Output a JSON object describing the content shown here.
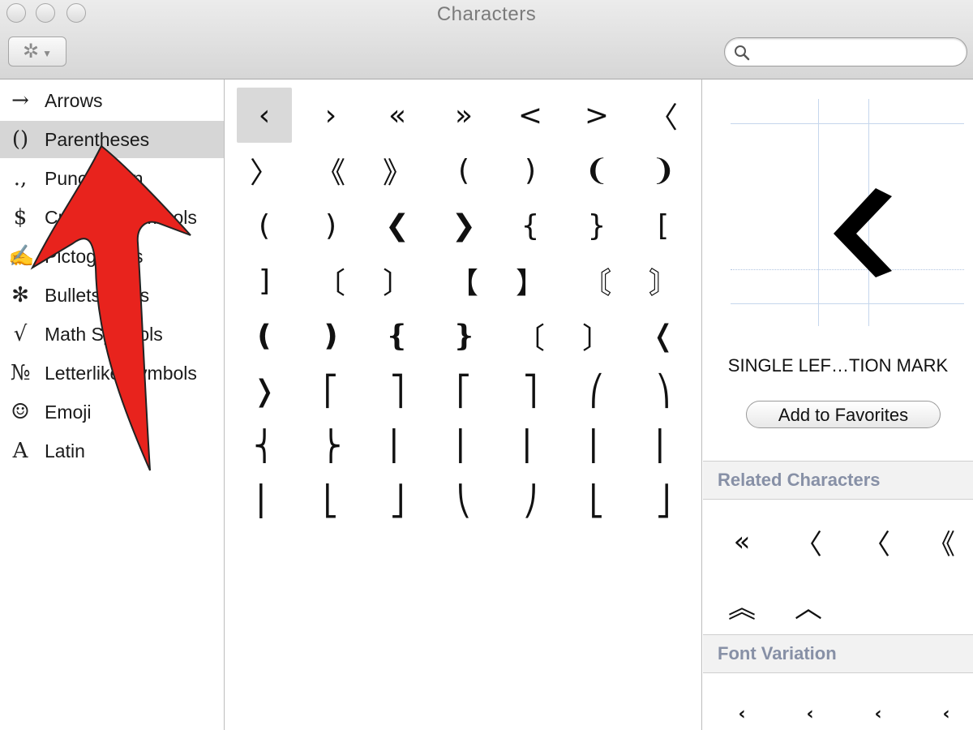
{
  "window": {
    "title": "Characters"
  },
  "toolbar": {
    "gear_icon": "gear-icon",
    "search_placeholder": ""
  },
  "sidebar": {
    "items": [
      {
        "glyph": "→",
        "label": "Arrows"
      },
      {
        "glyph": "()",
        "label": "Parentheses",
        "selected": true
      },
      {
        "glyph": ".,",
        "label": "Punctuation"
      },
      {
        "glyph": "$",
        "label": "Currency Symbols"
      },
      {
        "glyph": "✍",
        "label": "Pictographs"
      },
      {
        "glyph": "✻",
        "label": "Bullets/Stars"
      },
      {
        "glyph": "√",
        "label": "Math Symbols"
      },
      {
        "glyph": "№",
        "label": "Letterlike Symbols"
      },
      {
        "glyph": "☺",
        "label": "Emoji"
      },
      {
        "glyph": "A",
        "label": "Latin"
      }
    ]
  },
  "grid": {
    "selected_index": 0,
    "characters": [
      "‹",
      "›",
      "«",
      "»",
      "<",
      ">",
      "〈",
      "〉",
      "《",
      "》",
      "(",
      ")",
      "❨",
      "❩",
      "(",
      ")",
      "❮",
      "❯",
      "{",
      "}",
      "[",
      "]",
      "〔",
      "〕",
      "【",
      "】",
      "〘",
      "〙",
      "❪",
      "❫",
      "❴",
      "❵",
      "〔",
      "〕",
      "❬",
      "❭",
      "⎡",
      "⎤",
      "⎡",
      "⎤",
      "⎛",
      "⎞",
      "⎨",
      "⎬",
      "⎢",
      "⎢",
      "⎢",
      "⎢",
      "⎢",
      "⎢",
      "⎣",
      "⎦",
      "⎝",
      "⎠",
      "⎣",
      "⎦"
    ]
  },
  "info": {
    "preview_char": "‹",
    "name": "SINGLE LEF…TION MARK",
    "add_favorites_label": "Add to Favorites",
    "related_heading": "Related Characters",
    "related": [
      "«",
      "〈",
      "〈",
      "《",
      "︽",
      "︿"
    ],
    "font_variation_heading": "Font Variation",
    "variations": [
      "‹",
      "‹",
      "‹",
      "‹"
    ]
  },
  "annotation": {
    "color": "#e8231d"
  }
}
